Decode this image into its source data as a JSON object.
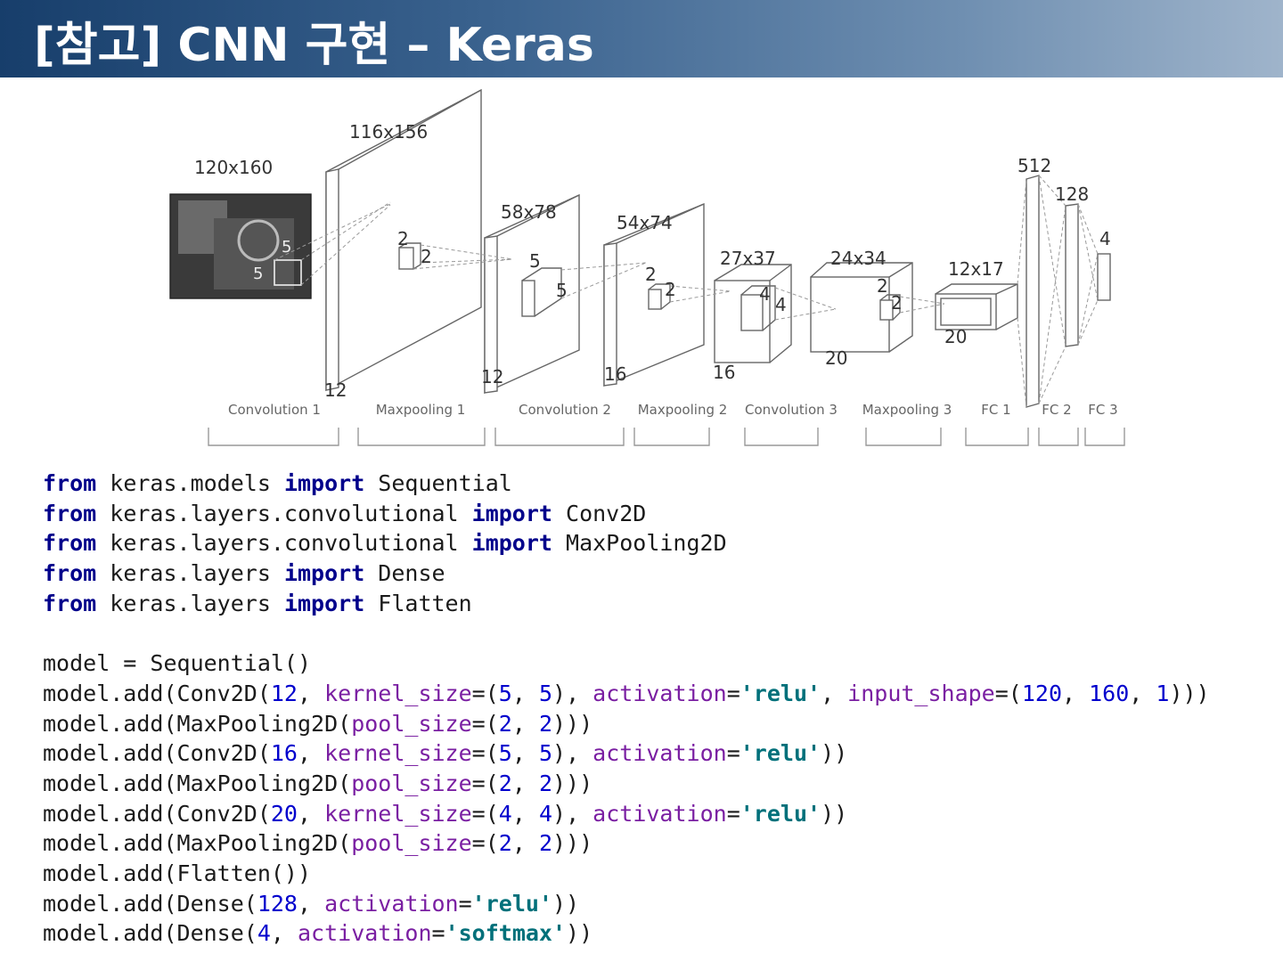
{
  "header": {
    "title": "[참고] CNN 구현 – Keras"
  },
  "diagram": {
    "input_size": "120x160",
    "kernel1_a": "5",
    "kernel1_b": "5",
    "conv1_size": "116x156",
    "conv1_depth": "12",
    "pool1_a": "2",
    "pool1_b": "2",
    "conv2_size": "58x78",
    "conv2_depth": "12",
    "kernel2_a": "5",
    "kernel2_b": "5",
    "pool2_size": "54x74",
    "pool2_depth": "16",
    "pool2_a": "2",
    "pool2_b": "2",
    "conv3_size": "27x37",
    "conv3_depth": "16",
    "kernel3_a": "4",
    "kernel3_b": "4",
    "pool3_size": "24x34",
    "pool3_depth": "20",
    "pool3_a": "2",
    "pool3_b": "2",
    "flat_size": "12x17",
    "flat_depth": "20",
    "fc1_units": "512",
    "fc2_units": "128",
    "fc3_units": "4",
    "stages": [
      "Convolution 1",
      "Maxpooling 1",
      "Convolution 2",
      "Maxpooling 2",
      "Convolution 3",
      "Maxpooling 3",
      "FC 1",
      "FC 2",
      "FC 3"
    ]
  },
  "code": {
    "lines": [
      [
        [
          "kw",
          "from"
        ],
        [
          "t",
          " keras.models "
        ],
        [
          "kw",
          "import"
        ],
        [
          "t",
          " Sequential"
        ]
      ],
      [
        [
          "kw",
          "from"
        ],
        [
          "t",
          " keras.layers.convolutional "
        ],
        [
          "kw",
          "import"
        ],
        [
          "t",
          " Conv2D"
        ]
      ],
      [
        [
          "kw",
          "from"
        ],
        [
          "t",
          " keras.layers.convolutional "
        ],
        [
          "kw",
          "import"
        ],
        [
          "t",
          " MaxPooling2D"
        ]
      ],
      [
        [
          "kw",
          "from"
        ],
        [
          "t",
          " keras.layers "
        ],
        [
          "kw",
          "import"
        ],
        [
          "t",
          " Dense"
        ]
      ],
      [
        [
          "kw",
          "from"
        ],
        [
          "t",
          " keras.layers "
        ],
        [
          "kw",
          "import"
        ],
        [
          "t",
          " Flatten"
        ]
      ],
      [],
      [
        [
          "t",
          "model = Sequential()"
        ]
      ],
      [
        [
          "t",
          "model.add(Conv2D("
        ],
        [
          "num",
          "12"
        ],
        [
          "t",
          ", "
        ],
        [
          "arg",
          "kernel_size"
        ],
        [
          "t",
          "=("
        ],
        [
          "num",
          "5"
        ],
        [
          "t",
          ", "
        ],
        [
          "num",
          "5"
        ],
        [
          "t",
          "), "
        ],
        [
          "arg",
          "activation"
        ],
        [
          "t",
          "="
        ],
        [
          "str",
          "'relu'"
        ],
        [
          "t",
          ", "
        ],
        [
          "arg",
          "input_shape"
        ],
        [
          "t",
          "=("
        ],
        [
          "num",
          "120"
        ],
        [
          "t",
          ", "
        ],
        [
          "num",
          "160"
        ],
        [
          "t",
          ", "
        ],
        [
          "num",
          "1"
        ],
        [
          "t",
          ")))"
        ]
      ],
      [
        [
          "t",
          "model.add(MaxPooling2D("
        ],
        [
          "arg",
          "pool_size"
        ],
        [
          "t",
          "=("
        ],
        [
          "num",
          "2"
        ],
        [
          "t",
          ", "
        ],
        [
          "num",
          "2"
        ],
        [
          "t",
          ")))"
        ]
      ],
      [
        [
          "t",
          "model.add(Conv2D("
        ],
        [
          "num",
          "16"
        ],
        [
          "t",
          ", "
        ],
        [
          "arg",
          "kernel_size"
        ],
        [
          "t",
          "=("
        ],
        [
          "num",
          "5"
        ],
        [
          "t",
          ", "
        ],
        [
          "num",
          "5"
        ],
        [
          "t",
          "), "
        ],
        [
          "arg",
          "activation"
        ],
        [
          "t",
          "="
        ],
        [
          "str",
          "'relu'"
        ],
        [
          "t",
          "))"
        ]
      ],
      [
        [
          "t",
          "model.add(MaxPooling2D("
        ],
        [
          "arg",
          "pool_size"
        ],
        [
          "t",
          "=("
        ],
        [
          "num",
          "2"
        ],
        [
          "t",
          ", "
        ],
        [
          "num",
          "2"
        ],
        [
          "t",
          ")))"
        ]
      ],
      [
        [
          "t",
          "model.add(Conv2D("
        ],
        [
          "num",
          "20"
        ],
        [
          "t",
          ", "
        ],
        [
          "arg",
          "kernel_size"
        ],
        [
          "t",
          "=("
        ],
        [
          "num",
          "4"
        ],
        [
          "t",
          ", "
        ],
        [
          "num",
          "4"
        ],
        [
          "t",
          "), "
        ],
        [
          "arg",
          "activation"
        ],
        [
          "t",
          "="
        ],
        [
          "str",
          "'relu'"
        ],
        [
          "t",
          "))"
        ]
      ],
      [
        [
          "t",
          "model.add(MaxPooling2D("
        ],
        [
          "arg",
          "pool_size"
        ],
        [
          "t",
          "=("
        ],
        [
          "num",
          "2"
        ],
        [
          "t",
          ", "
        ],
        [
          "num",
          "2"
        ],
        [
          "t",
          ")))"
        ]
      ],
      [
        [
          "t",
          "model.add(Flatten())"
        ]
      ],
      [
        [
          "t",
          "model.add(Dense("
        ],
        [
          "num",
          "128"
        ],
        [
          "t",
          ", "
        ],
        [
          "arg",
          "activation"
        ],
        [
          "t",
          "="
        ],
        [
          "str",
          "'relu'"
        ],
        [
          "t",
          "))"
        ]
      ],
      [
        [
          "t",
          "model.add(Dense("
        ],
        [
          "num",
          "4"
        ],
        [
          "t",
          ", "
        ],
        [
          "arg",
          "activation"
        ],
        [
          "t",
          "="
        ],
        [
          "str",
          "'softmax'"
        ],
        [
          "t",
          "))"
        ]
      ]
    ]
  }
}
